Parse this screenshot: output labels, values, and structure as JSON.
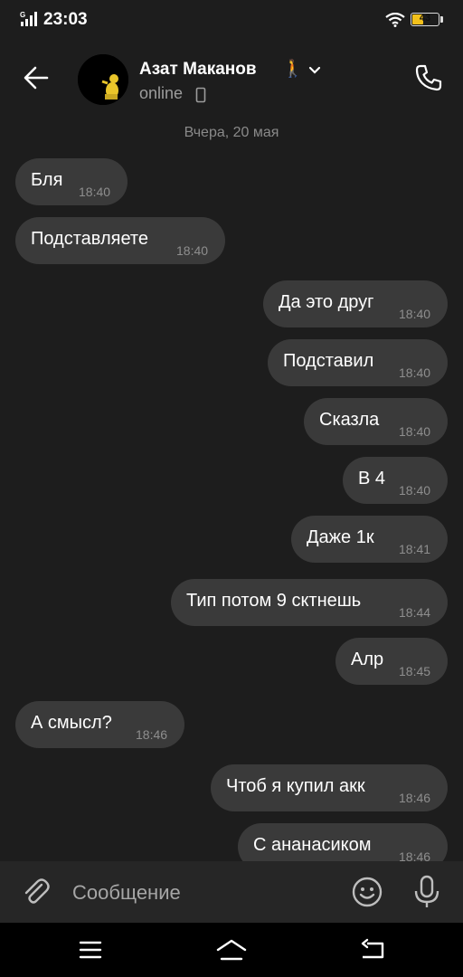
{
  "status_bar": {
    "time": "23:03",
    "network": "G",
    "battery": "43"
  },
  "header": {
    "contact_name": "Азат Маканов",
    "name_emoji": "🚶",
    "status": "online",
    "icons": {
      "back": "arrow-left-icon",
      "call": "phone-icon",
      "expand": "chevron-down-icon",
      "device": "mobile-device-icon"
    }
  },
  "chat": {
    "date_separator": "Вчера, 20 мая",
    "messages": [
      {
        "text": "Бля",
        "time": "18:40",
        "direction": "incoming"
      },
      {
        "text": "Подставляете",
        "time": "18:40",
        "direction": "incoming"
      },
      {
        "text": "Да это друг",
        "time": "18:40",
        "direction": "outgoing"
      },
      {
        "text": "Подставил",
        "time": "18:40",
        "direction": "outgoing"
      },
      {
        "text": "Сказла",
        "time": "18:40",
        "direction": "outgoing"
      },
      {
        "text": "В 4",
        "time": "18:40",
        "direction": "outgoing"
      },
      {
        "text": "Даже 1к",
        "time": "18:41",
        "direction": "outgoing"
      },
      {
        "text": "Тип потом 9 сктнешь",
        "time": "18:44",
        "direction": "outgoing"
      },
      {
        "text": "Алр",
        "time": "18:45",
        "direction": "outgoing"
      },
      {
        "text": "А смысл?",
        "time": "18:46",
        "direction": "incoming"
      },
      {
        "text": "Чтоб я купил акк",
        "time": "18:46",
        "direction": "outgoing"
      },
      {
        "text": "С ананасиком",
        "time": "18:46",
        "direction": "outgoing"
      }
    ]
  },
  "composer": {
    "placeholder": "Сообщение",
    "value": "",
    "icons": {
      "attach": "paperclip-icon",
      "emoji": "smiley-icon",
      "mic": "microphone-icon"
    }
  },
  "navbar": {
    "icons": [
      "menu-icon",
      "home-icon",
      "back-icon"
    ]
  },
  "colors": {
    "background": "#1d1d1d",
    "bubble": "#3a3a3a",
    "composer": "#262626",
    "battery": "#f2c01b"
  }
}
